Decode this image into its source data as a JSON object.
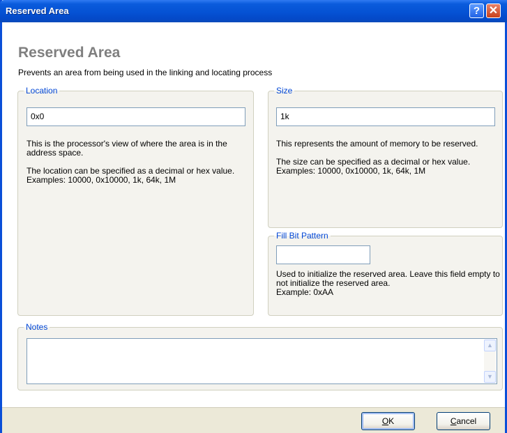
{
  "window": {
    "title": "Reserved Area",
    "help_glyph": "?",
    "close_glyph": "✕"
  },
  "header": {
    "heading": "Reserved Area",
    "subheading": "Prevents an area from being used in the linking and locating process"
  },
  "location": {
    "legend": "Location",
    "value": "0x0",
    "desc1": "This is the processor's view of where the area is in the address space.",
    "desc2": "The location can be specified as a decimal or hex value.",
    "desc3": "Examples: 10000, 0x10000, 1k, 64k, 1M"
  },
  "size": {
    "legend": "Size",
    "value": "1k",
    "desc1": "This represents the amount of memory to be reserved.",
    "desc2": "The size can be specified as a decimal or hex value.",
    "desc3": "Examples: 10000, 0x10000, 1k, 64k, 1M"
  },
  "fill": {
    "legend": "Fill Bit Pattern",
    "value": "",
    "desc": "Used to initialize the reserved area. Leave this field empty to not initialize the reserved area.",
    "example": "Example: 0xAA"
  },
  "notes": {
    "legend": "Notes",
    "value": ""
  },
  "buttons": {
    "ok_mnemonic": "O",
    "ok_rest": "K",
    "cancel_mnemonic": "C",
    "cancel_rest": "ancel"
  },
  "colors": {
    "accent": "#0046d5",
    "titlebar": "#0552d4",
    "heading": "#7f7f7f"
  }
}
